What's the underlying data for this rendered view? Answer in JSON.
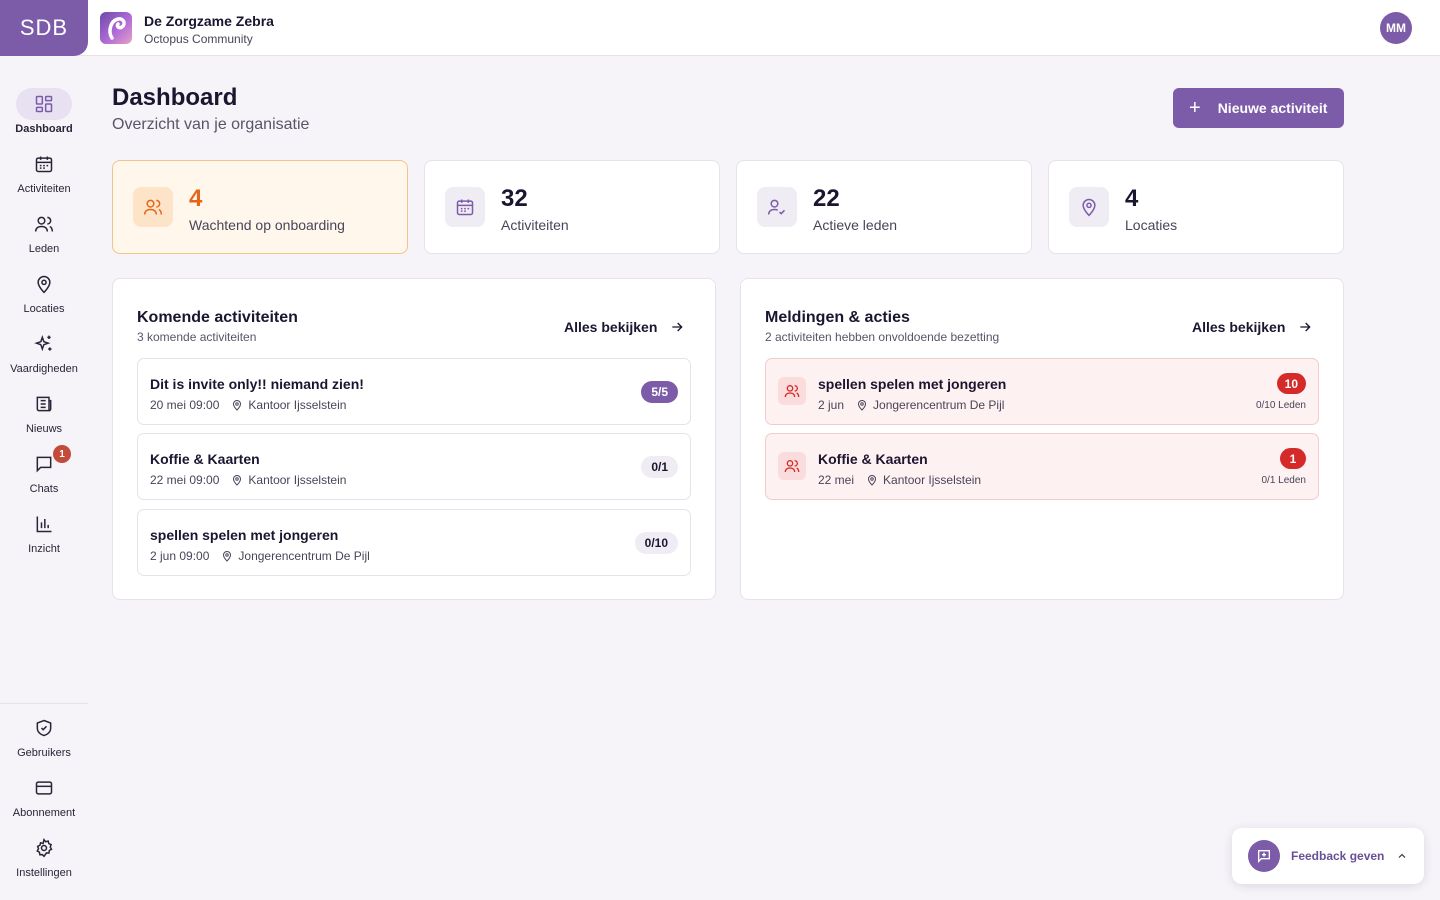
{
  "brand": {
    "logo_text": "SDB",
    "accent": "#7c5ca8"
  },
  "org": {
    "name": "De Zorgzame Zebra",
    "subtitle": "Octopus Community"
  },
  "user": {
    "initials": "MM"
  },
  "sidebar": {
    "items": [
      {
        "label": "Dashboard",
        "icon": "grid-icon",
        "active": true
      },
      {
        "label": "Activiteiten",
        "icon": "calendar-icon"
      },
      {
        "label": "Leden",
        "icon": "users-icon"
      },
      {
        "label": "Locaties",
        "icon": "map-pin-icon"
      },
      {
        "label": "Vaardigheden",
        "icon": "sparkles-icon"
      },
      {
        "label": "Nieuws",
        "icon": "newspaper-icon"
      },
      {
        "label": "Chats",
        "icon": "chat-icon",
        "badge": "1"
      },
      {
        "label": "Inzicht",
        "icon": "bar-chart-icon"
      }
    ],
    "bottom_items": [
      {
        "label": "Gebruikers",
        "icon": "shield-check-icon"
      },
      {
        "label": "Abonnement",
        "icon": "credit-card-icon"
      },
      {
        "label": "Instellingen",
        "icon": "gear-icon"
      }
    ]
  },
  "header": {
    "title": "Dashboard",
    "subtitle": "Overzicht van je organisatie",
    "new_button": "Nieuwe activiteit"
  },
  "stats": [
    {
      "value": "4",
      "label": "Wachtend op onboarding",
      "icon": "users-icon",
      "highlight": true
    },
    {
      "value": "32",
      "label": "Activiteiten",
      "icon": "calendar-icon"
    },
    {
      "value": "22",
      "label": "Actieve leden",
      "icon": "user-check-icon"
    },
    {
      "value": "4",
      "label": "Locaties",
      "icon": "map-pin-icon"
    }
  ],
  "upcoming": {
    "title": "Komende activiteiten",
    "subtitle": "3 komende activiteiten",
    "see_all": "Alles bekijken",
    "items": [
      {
        "title": "Dit is invite only!! niemand zien!",
        "date": "20 mei 09:00",
        "location": "Kantoor Ijsselstein",
        "occupancy": "5/5"
      },
      {
        "title": "Koffie & Kaarten",
        "date": "22 mei 09:00",
        "location": "Kantoor Ijsselstein",
        "occupancy": "0/1"
      },
      {
        "title": "spellen spelen met jongeren",
        "date": "2 jun 09:00",
        "location": "Jongerencentrum De Pijl",
        "occupancy": "0/10"
      }
    ]
  },
  "alerts": {
    "title": "Meldingen & acties",
    "subtitle": "2 activiteiten hebben onvoldoende bezetting",
    "see_all": "Alles bekijken",
    "items": [
      {
        "title": "spellen spelen met jongeren",
        "date": "2 jun",
        "location": "Jongerencentrum De Pijl",
        "count": "10",
        "members": "0/10 Leden"
      },
      {
        "title": "Koffie & Kaarten",
        "date": "22 mei",
        "location": "Kantoor Ijsselstein",
        "count": "1",
        "members": "0/1 Leden"
      }
    ]
  },
  "feedback": {
    "label": "Feedback geven"
  }
}
